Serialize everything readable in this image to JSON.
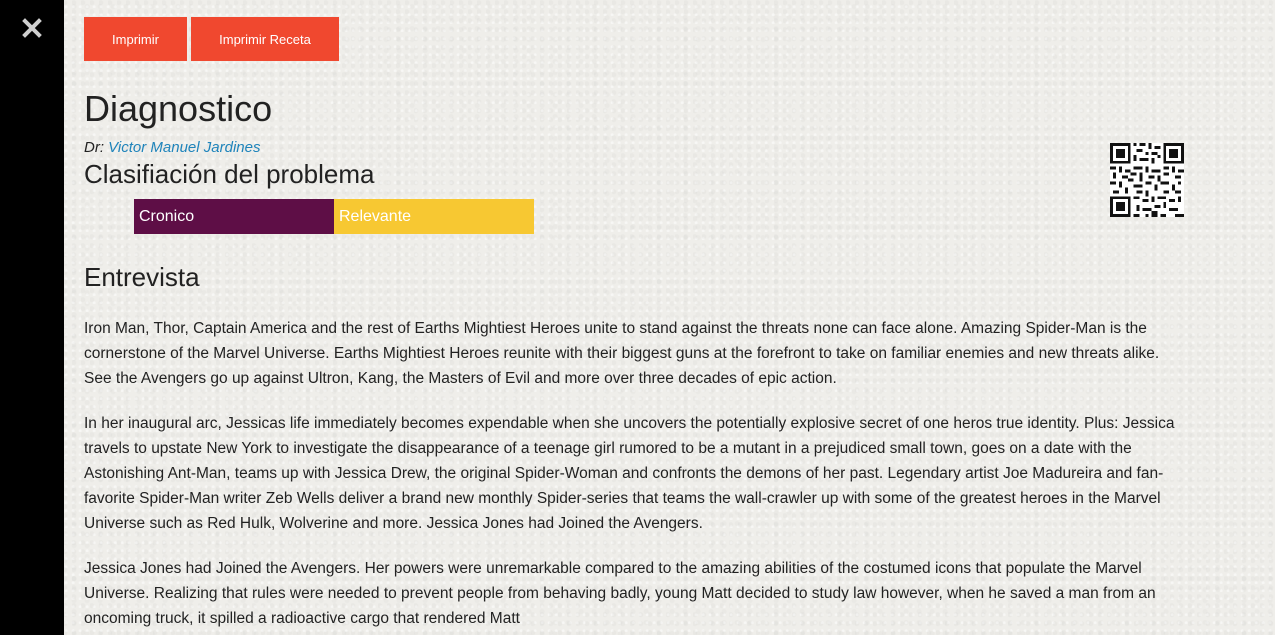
{
  "close": {
    "icon": "close-icon",
    "label": "✕"
  },
  "toolbar": {
    "print_label": "Imprimir",
    "print_recipe_label": "Imprimir Receta"
  },
  "title": "Diagnostico",
  "doctor": {
    "prefix": "Dr:",
    "name": "Victor Manuel Jardines"
  },
  "classification": {
    "title": "Clasifiación del problema",
    "tags": [
      {
        "label": "Cronico",
        "color": "#5e0e46"
      },
      {
        "label": "Relevante",
        "color": "#f7c832"
      }
    ]
  },
  "interview": {
    "title": "Entrevista",
    "paragraphs": [
      "Iron Man, Thor, Captain America and the rest of Earths Mightiest Heroes unite to stand against the threats none can face alone. Amazing Spider-Man is the cornerstone of the Marvel Universe. Earths Mightiest Heroes reunite with their biggest guns at the forefront to take on familiar enemies and new threats alike. See the Avengers go up against Ultron, Kang, the Masters of Evil and more over three decades of epic action.",
      "In her inaugural arc, Jessicas life immediately becomes expendable when she uncovers the potentially explosive secret of one heros true identity. Plus: Jessica travels to upstate New York to investigate the disappearance of a teenage girl rumored to be a mutant in a prejudiced small town, goes on a date with the Astonishing Ant-Man, teams up with Jessica Drew, the original Spider-Woman and confronts the demons of her past. Legendary artist Joe Madureira and fan-favorite Spider-Man writer Zeb Wells deliver a brand new monthly Spider-series that teams the wall-crawler up with some of the greatest heroes in the Marvel Universe such as Red Hulk, Wolverine and more. Jessica Jones had Joined the Avengers.",
      "Jessica Jones had Joined the Avengers. Her powers were unremarkable compared to the amazing abilities of the costumed icons that populate the Marvel Universe. Realizing that rules were needed to prevent people from behaving badly, young Matt decided to study law however, when he saved a man from an oncoming truck, it spilled a radioactive cargo that rendered Matt"
    ]
  },
  "qr": {
    "icon": "qr-code-icon"
  },
  "colors": {
    "button": "#f0482f",
    "link": "#1f84bb",
    "sidebar": "#000000"
  }
}
